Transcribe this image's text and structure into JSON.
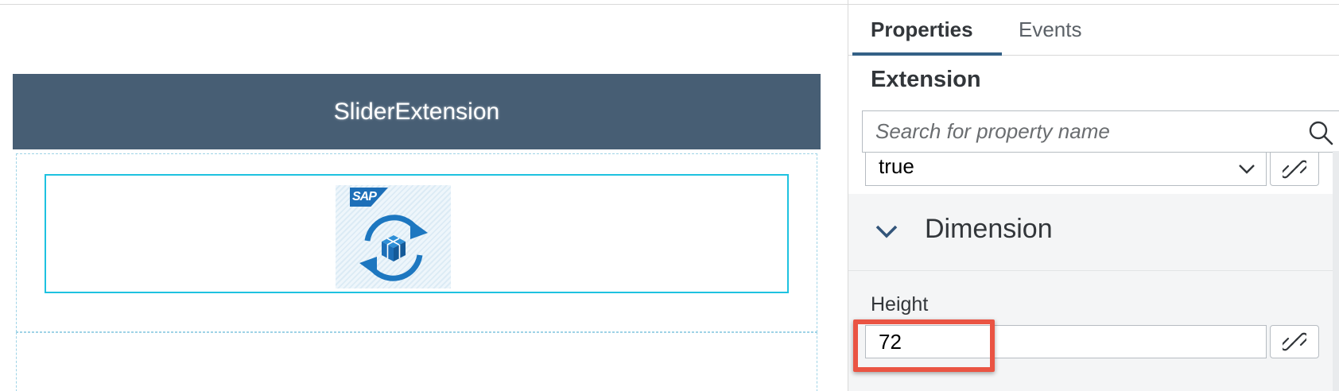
{
  "canvas": {
    "page_title": "SliderExtension",
    "extension_logo_text": "SAP"
  },
  "panel": {
    "tabs": [
      {
        "label": "Properties",
        "active": true
      },
      {
        "label": "Events",
        "active": false
      }
    ],
    "heading": "Extension",
    "search": {
      "placeholder": "Search for property name",
      "value": ""
    },
    "boolean_select": {
      "value": "true"
    },
    "dimension_section": {
      "title": "Dimension",
      "expanded": true
    },
    "height": {
      "label": "Height",
      "value": "72"
    }
  },
  "icons": {
    "search": "search-icon",
    "chevron": "chevron-down-icon",
    "link": "link-icon"
  },
  "colors": {
    "header_bg": "#475e74",
    "selection_border": "#1ec2e0",
    "tab_underline": "#346187",
    "highlight": "#ea5443"
  }
}
